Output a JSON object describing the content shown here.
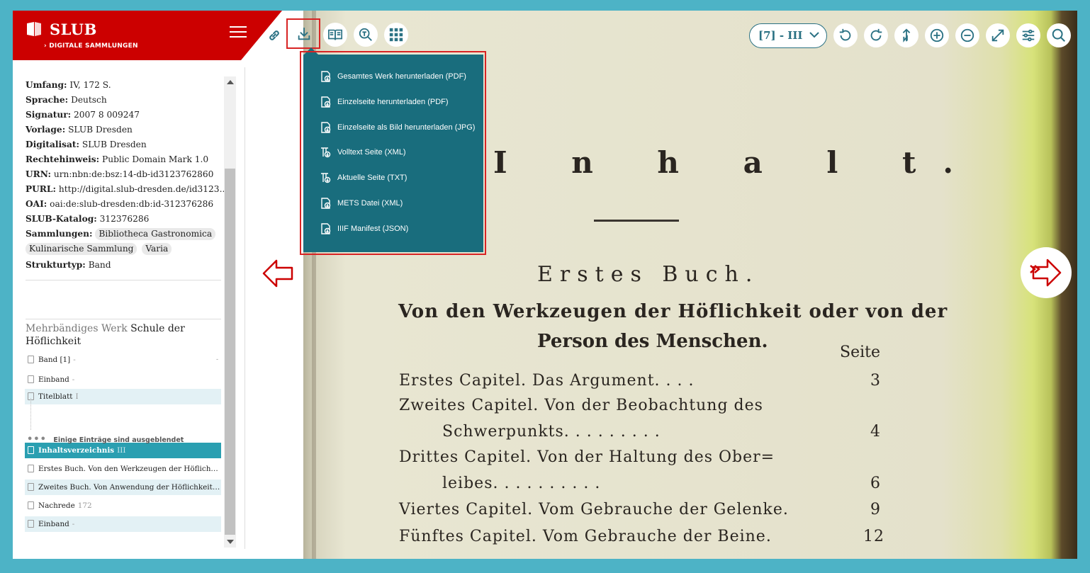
{
  "brand": {
    "title": "SLUB",
    "subtitle": "› DIGITALE SAMMLUNGEN"
  },
  "metadata": [
    {
      "label": "Umfang:",
      "value": "IV, 172 S."
    },
    {
      "label": "Sprache:",
      "value": "Deutsch"
    },
    {
      "label": "Signatur:",
      "value": "2007 8 009247"
    },
    {
      "label": "Vorlage:",
      "value": "SLUB Dresden"
    },
    {
      "label": "Digitalisat:",
      "value": "SLUB Dresden"
    },
    {
      "label": "Rechtehinweis:",
      "value": "Public Domain Mark 1.0"
    },
    {
      "label": "URN:",
      "value": "urn:nbn:de:bsz:14-db-id3123762860"
    },
    {
      "label": "PURL:",
      "value": "http://digital.slub-dresden.de/id3123..."
    },
    {
      "label": "OAI:",
      "value": "oai:de:slub-dresden:db:id-312376286"
    },
    {
      "label": "SLUB-Katalog:",
      "value": "312376286"
    }
  ],
  "collections": {
    "label": "Sammlungen:",
    "tags": [
      "Bibliotheca Gastronomica",
      "Kulinarische Sammlung",
      "Varia"
    ]
  },
  "structure": {
    "label": "Strukturtyp:",
    "value": "Band"
  },
  "werk": {
    "label": "Mehrbändiges Werk",
    "title": "Schule der Höflichkeit"
  },
  "tree": {
    "items": [
      {
        "label": "Band [1]",
        "page": "-",
        "right": "-",
        "state": "normal"
      },
      {
        "label": "Einband",
        "page": "-",
        "state": "normal"
      },
      {
        "label": "Titelblatt",
        "page": "I",
        "state": "highlight"
      },
      {
        "label": "Inhaltsverzeichnis",
        "page": "III",
        "state": "active"
      },
      {
        "label": "Erstes Buch. Von den Werkzeugen der Höflichkeit oder von der Person des Menschen",
        "page": "",
        "state": "normal"
      },
      {
        "label": "Zweites Buch. Von Anwendung der Höflichkeit und Wohlanständigkeit",
        "page": "",
        "state": "highlight"
      },
      {
        "label": "Nachrede",
        "page": "172",
        "state": "normal"
      },
      {
        "label": "Einband",
        "page": "-",
        "state": "highlight"
      }
    ],
    "hidden_notice": "Einige Einträge sind ausgeblendet"
  },
  "toolbar": {
    "page_select": "[7] - III",
    "icons": [
      "link-icon",
      "download-icon",
      "book-icon",
      "search-text-icon",
      "grid-icon",
      "rotate-left-icon",
      "rotate-right-icon",
      "north-icon",
      "zoom-in-icon",
      "zoom-out-icon",
      "fullscreen-icon",
      "settings-icon",
      "search-icon"
    ]
  },
  "download_menu": [
    {
      "label": "Gesamtes Werk herunterladen (PDF)",
      "icon": "pdf-download-icon"
    },
    {
      "label": "Einzelseite herunterladen (PDF)",
      "icon": "pdf-download-icon"
    },
    {
      "label": "Einzelseite als Bild herunterladen (JPG)",
      "icon": "image-download-icon"
    },
    {
      "label": "Volltext Seite (XML)",
      "icon": "fulltext-icon"
    },
    {
      "label": "Aktuelle Seite (TXT)",
      "icon": "fulltext-icon"
    },
    {
      "label": "METS Datei (XML)",
      "icon": "mets-icon"
    },
    {
      "label": "IIIF Manifest (JSON)",
      "icon": "iiif-icon"
    }
  ],
  "scan": {
    "heading": "I n h a l t.",
    "book": "Erstes Buch.",
    "subtitle1": "Von den Werkzeugen der Höflichkeit oder von der",
    "subtitle2": "Person des Menschen.",
    "seite": "Seite",
    "toc": [
      {
        "text": "Erstes Capitel.   Das Argument.   .   .   .",
        "page": "3"
      },
      {
        "text": "Zweites Capitel.   Von der Beobachtung des",
        "page": ""
      },
      {
        "text": "Schwerpunkts.   .   .   .   .   .   .   .   .",
        "page": "4"
      },
      {
        "text": "Drittes Capitel.   Von der Haltung des Ober=",
        "page": ""
      },
      {
        "text": "leibes.   .   .   .   .   .   .   .   .   .",
        "page": "6"
      },
      {
        "text": "Viertes Capitel.   Vom Gebrauche der Gelenke.",
        "page": "9"
      },
      {
        "text": "Fünftes Capitel.   Vom Gebrauche der Beine.",
        "page": "12"
      }
    ]
  },
  "colors": {
    "frame": "#4db3c6",
    "brand_red": "#cc0000",
    "menu_bg": "#196d7d",
    "accent": "#2a9fb1",
    "highlight_box": "#d82424"
  }
}
